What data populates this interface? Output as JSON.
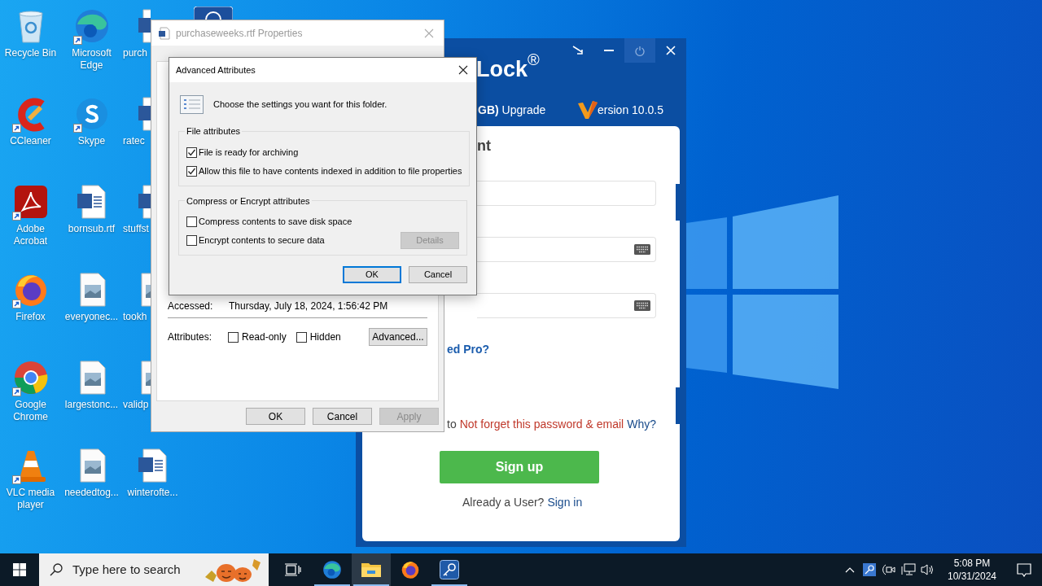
{
  "desktop": {
    "icons": [
      {
        "label": "Recycle Bin",
        "kind": "recycle",
        "shortcut": false,
        "covered": false
      },
      {
        "label": "CCleaner",
        "kind": "ccleaner",
        "shortcut": true,
        "covered": false
      },
      {
        "label": "Adobe Acrobat",
        "kind": "acrobat",
        "shortcut": true,
        "covered": false
      },
      {
        "label": "Firefox",
        "kind": "firefox",
        "shortcut": true,
        "covered": false
      },
      {
        "label": "Google Chrome",
        "kind": "chrome",
        "shortcut": true,
        "covered": false
      },
      {
        "label": "VLC media player",
        "kind": "vlc",
        "shortcut": true,
        "covered": false
      },
      {
        "label": "Microsoft Edge",
        "kind": "edge",
        "shortcut": true,
        "covered": false
      },
      {
        "label": "Skype",
        "kind": "skype",
        "shortcut": true,
        "covered": false
      },
      {
        "label": "bornsub.rtf",
        "kind": "word",
        "shortcut": false,
        "covered": false
      },
      {
        "label": "everyonec...",
        "kind": "image",
        "shortcut": false,
        "covered": false
      },
      {
        "label": "largestonc...",
        "kind": "image",
        "shortcut": false,
        "covered": false
      },
      {
        "label": "neededtog...",
        "kind": "image",
        "shortcut": false,
        "covered": false
      },
      {
        "label": "purch",
        "kind": "word",
        "covered": true
      },
      {
        "label": "ratec",
        "kind": "word",
        "covered": true
      },
      {
        "label": "stuffst",
        "kind": "word",
        "covered": true
      },
      {
        "label": "tookh",
        "kind": "image",
        "covered": true
      },
      {
        "label": "validp",
        "kind": "image",
        "covered": true
      },
      {
        "label": "winterofte...",
        "kind": "word",
        "shortcut": false,
        "covered": false
      }
    ]
  },
  "app_window": {
    "title": "Lock",
    "title_mark": "®",
    "plan": "**GB)** Upgrade",
    "version": "ersion 10.0.5",
    "heading": "nt",
    "fields": [
      {
        "kind": "text"
      },
      {
        "kind": "keyboard"
      },
      {
        "kind": "keyboard"
      }
    ],
    "pro_link": "ed Pro?",
    "notice_prefix": "to",
    "notice_warning": "Not forget this password & email",
    "notice_link": "Why?",
    "signup_button": "Sign up",
    "signin_prompt": "Already a User?",
    "signin_link": "Sign in"
  },
  "properties_window": {
    "title": "purchaseweeks.rtf Properties",
    "accessed_label": "Accessed:",
    "accessed_value": "Thursday, July 18, 2024, 1:56:42 PM",
    "attributes_label": "Attributes:",
    "attributes": [
      {
        "label": "Read-only",
        "checked": false
      },
      {
        "label": "Hidden",
        "checked": false
      }
    ],
    "advanced_button": "Advanced...",
    "buttons": [
      {
        "label": "OK",
        "disabled": false
      },
      {
        "label": "Cancel",
        "disabled": false
      },
      {
        "label": "Apply",
        "disabled": true
      }
    ]
  },
  "advanced_dialog": {
    "title": "Advanced Attributes",
    "description": "Choose the settings you want for this folder.",
    "groups": [
      {
        "title": "File attributes",
        "options": [
          {
            "label": "File is ready for archiving",
            "checked": true
          },
          {
            "label": "Allow this file to have contents indexed in addition to file properties",
            "checked": true
          }
        ]
      },
      {
        "title": "Compress or Encrypt attributes",
        "options": [
          {
            "label": "Compress contents to save disk space",
            "checked": false
          },
          {
            "label": "Encrypt contents to secure data",
            "checked": false
          }
        ]
      }
    ],
    "details_button": {
      "label": "Details",
      "disabled": true
    },
    "buttons": [
      {
        "label": "OK",
        "default": true
      },
      {
        "label": "Cancel",
        "default": false
      }
    ]
  },
  "taskbar": {
    "search_placeholder": "Type here to search",
    "apps": [
      {
        "kind": "edge",
        "selected": false,
        "running": true
      },
      {
        "kind": "folder",
        "selected": true,
        "running": true
      },
      {
        "kind": "firefox",
        "selected": false,
        "running": false
      },
      {
        "kind": "key",
        "selected": false,
        "running": true
      }
    ],
    "time": "5:08 PM",
    "date": "10/31/2024"
  }
}
